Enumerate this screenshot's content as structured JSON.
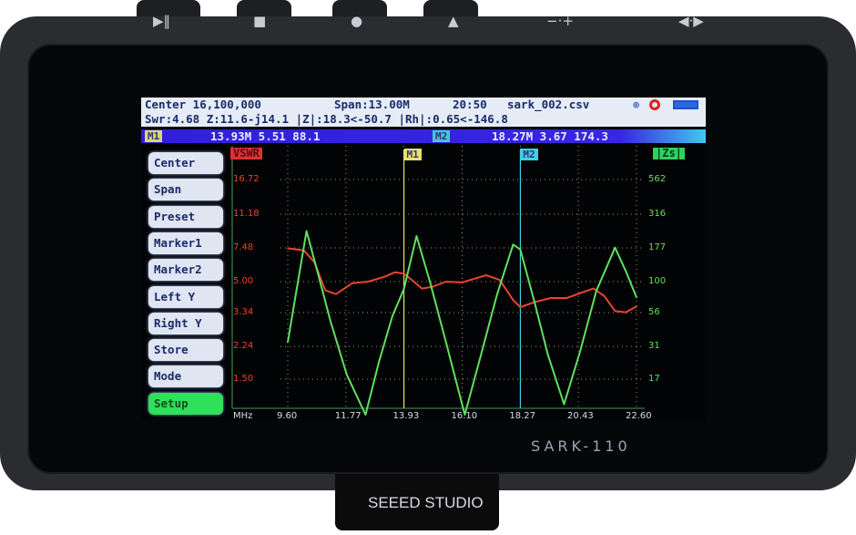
{
  "device": {
    "model_logo": "SARK-110",
    "brand_logo": "SEEED STUDIO",
    "hardware_buttons": [
      {
        "icon": "play-pause-icon",
        "glyph": "▶‖"
      },
      {
        "icon": "stop-icon",
        "glyph": "■"
      },
      {
        "icon": "record-icon",
        "glyph": "●"
      },
      {
        "icon": "up-icon",
        "glyph": "▲"
      },
      {
        "icon": "volume-icon",
        "glyph": "−·+"
      },
      {
        "icon": "seek-icon",
        "glyph": "◀·▶"
      }
    ]
  },
  "header": {
    "center": "Center 16,100,000",
    "span": "Span:13.00M",
    "time": "20:50",
    "file": "sark_002.csv",
    "line2": "Swr:4.68 Z:11.6-j14.1 |Z|:18.3<-50.7 |Rh|:0.65<-146.8"
  },
  "markers": {
    "m1_tag": "M1",
    "m1_values": "13.93M 5.51 88.1",
    "m2_tag": "M2",
    "m2_values": "18.27M 3.67 174.3"
  },
  "menu": [
    {
      "label": "Center"
    },
    {
      "label": "Span"
    },
    {
      "label": "Preset"
    },
    {
      "label": "Marker1"
    },
    {
      "label": "Marker2"
    },
    {
      "label": "Left Y"
    },
    {
      "label": "Right Y"
    },
    {
      "label": "Store"
    },
    {
      "label": "Mode"
    },
    {
      "label": "Setup",
      "active": true
    }
  ],
  "colors": {
    "swr": "#e8442c",
    "zs": "#5fe060",
    "m1": "#e8e070",
    "m2": "#40d0e0"
  },
  "chart_data": {
    "type": "line",
    "xlabel": "MHz",
    "x_ticks": [
      "9.60",
      "11.77",
      "13.93",
      "16.10",
      "18.27",
      "20.43",
      "22.60"
    ],
    "xlim": [
      9.6,
      22.6
    ],
    "left_axis": {
      "label": "VSWR",
      "scale": "log",
      "ticks": [
        "16.72",
        "11.18",
        "7.48",
        "5.00",
        "3.34",
        "2.24",
        "1.50"
      ]
    },
    "right_axis": {
      "label": "|Zs|",
      "scale": "log",
      "ticks": [
        "562",
        "316",
        "177",
        "100",
        "56",
        "31",
        "17"
      ]
    },
    "grid": true,
    "markers": [
      {
        "name": "M1",
        "x": 13.93
      },
      {
        "name": "M2",
        "x": 18.27
      }
    ],
    "series": [
      {
        "name": "VSWR",
        "axis": "left",
        "x": [
          9.6,
          10.2,
          10.6,
          11.0,
          11.4,
          12.0,
          12.6,
          13.2,
          13.6,
          13.93,
          14.3,
          14.6,
          15.0,
          15.5,
          16.1,
          16.6,
          17.0,
          17.5,
          18.0,
          18.27,
          18.8,
          19.4,
          20.0,
          20.6,
          21.0,
          21.4,
          21.8,
          22.2,
          22.6
        ],
        "y": [
          7.48,
          7.3,
          6.3,
          4.5,
          4.3,
          4.9,
          5.0,
          5.3,
          5.6,
          5.51,
          5.0,
          4.6,
          4.7,
          5.0,
          4.95,
          5.2,
          5.4,
          5.1,
          4.0,
          3.67,
          3.9,
          4.1,
          4.1,
          4.4,
          4.6,
          4.2,
          3.5,
          3.45,
          3.7
        ]
      },
      {
        "name": "|Zs|",
        "axis": "right",
        "x": [
          9.6,
          9.9,
          10.3,
          10.7,
          11.2,
          11.8,
          12.5,
          13.0,
          13.5,
          13.93,
          14.4,
          14.9,
          15.5,
          16.2,
          16.8,
          17.4,
          18.0,
          18.27,
          18.8,
          19.3,
          19.9,
          20.5,
          21.1,
          21.8,
          22.2,
          22.6
        ],
        "y": [
          35,
          80,
          240,
          120,
          50,
          20,
          10,
          25,
          55,
          88.1,
          220,
          100,
          35,
          10,
          28,
          80,
          190,
          174.3,
          70,
          28,
          12,
          30,
          85,
          180,
          120,
          76
        ]
      }
    ]
  }
}
